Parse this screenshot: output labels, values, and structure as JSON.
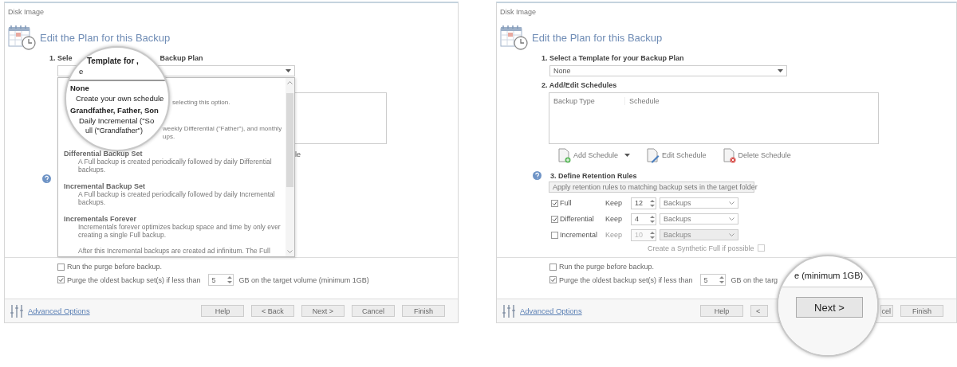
{
  "left_window": {
    "title": "Disk Image",
    "heading": "Edit the Plan for this Backup",
    "template_label_parts": [
      "1. Sele",
      "Backup Plan"
    ],
    "schedule_fragment": "le",
    "template_list": [
      {
        "kind": "lead",
        "text": "selecting this option."
      },
      {
        "kind": "lead",
        "text": "weekly Differential (\"Father\"), and monthly"
      },
      {
        "kind": "tail",
        "text": "ups."
      },
      {
        "kind": "title",
        "text": "Differential Backup Set"
      },
      {
        "kind": "desc",
        "text": "A Full backup is created periodically followed by daily Differential"
      },
      {
        "kind": "desc",
        "text": "backups."
      },
      {
        "kind": "title",
        "text": "Incremental Backup Set"
      },
      {
        "kind": "desc",
        "text": "A Full backup is created periodically followed by daily Incremental"
      },
      {
        "kind": "desc",
        "text": "backups."
      },
      {
        "kind": "title",
        "text": "Incrementals Forever"
      },
      {
        "kind": "desc",
        "text": "Incrementals forever optimizes backup space and time by only ever"
      },
      {
        "kind": "desc",
        "text": "creating a single Full backup."
      },
      {
        "kind": "gapdesc",
        "text": "After this Incremental backups are created ad infinitum. The Full"
      }
    ],
    "purge_options": [
      {
        "label": "Run the purge before backup.",
        "checked": false
      },
      {
        "label": "Purge the oldest backup set(s) if less than",
        "checked": true,
        "value": "5",
        "suffix": "GB on the target volume (minimum 1GB)"
      }
    ],
    "advanced_link": "Advanced Options",
    "buttons": [
      {
        "label": "Help",
        "kind": "full"
      },
      {
        "label": "< Back",
        "kind": "full"
      },
      {
        "label": "Next >",
        "kind": "full"
      },
      {
        "label": "Cancel",
        "kind": "full"
      },
      {
        "label": "Finish",
        "kind": "full"
      }
    ]
  },
  "left_magnifier": {
    "texts": [
      {
        "kind": "label",
        "text": "Template for ,"
      },
      {
        "kind": "value",
        "text": "e"
      },
      {
        "kind": "title",
        "text": "None"
      },
      {
        "kind": "desc",
        "text": "Create your own schedule"
      },
      {
        "kind": "title",
        "text": "Grandfather, Father, Son"
      },
      {
        "kind": "desc",
        "text": "Daily Incremental (\"So"
      },
      {
        "kind": "desc",
        "text": "ull (\"Grandfather\")"
      }
    ]
  },
  "right_window": {
    "title": "Disk Image",
    "heading": "Edit the Plan for this Backup",
    "template_label": "1. Select a Template for your Backup Plan",
    "template_value": "None",
    "schedules_label": "2. Add/Edit Schedules",
    "schedule_columns": [
      "Backup Type",
      "Schedule"
    ],
    "schedule_actions": [
      {
        "label": "Add Schedule",
        "kind": "add"
      },
      {
        "label": "Edit Schedule",
        "kind": "edit"
      },
      {
        "label": "Delete Schedule",
        "kind": "delete"
      }
    ],
    "retention_label": "3. Define Retention Rules",
    "retention_mode": "Apply retention rules to matching backup sets in the target folder",
    "retention_rows": [
      {
        "label": "Full",
        "checked": true,
        "disabled": false,
        "keep": "Keep",
        "count": "12",
        "unit": "Backups"
      },
      {
        "label": "Differential",
        "checked": true,
        "disabled": false,
        "keep": "Keep",
        "count": "4",
        "unit": "Backups"
      },
      {
        "label": "Incremental",
        "checked": false,
        "disabled": true,
        "keep": "Keep",
        "count": "10",
        "unit": "Backups"
      }
    ],
    "synthetic": {
      "label": "Create a Synthetic Full if possible",
      "checked": false,
      "disabled": true
    },
    "purge_options": [
      {
        "label": "Run the purge before backup.",
        "checked": false
      },
      {
        "label": "Purge the oldest backup set(s) if less than",
        "checked": true,
        "value": "5",
        "suffix": "GB on the targ"
      }
    ],
    "advanced_link": "Advanced Options",
    "buttons": [
      {
        "label": "Help",
        "kind": "full"
      },
      {
        "label": "<",
        "kind": "cut-right"
      },
      {
        "label": "cel",
        "kind": "cut-left"
      },
      {
        "label": "Finish",
        "kind": "full"
      }
    ]
  },
  "right_magnifier": {
    "text": "e (minimum 1GB)",
    "button": "Next >"
  }
}
